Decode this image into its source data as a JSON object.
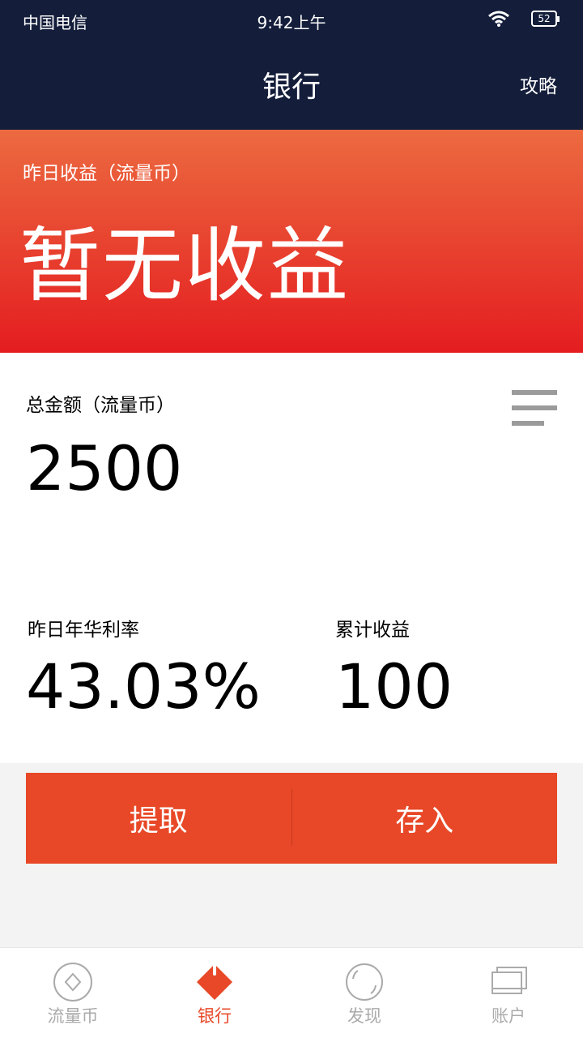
{
  "status_bar": {
    "carrier": "中国电信",
    "time": "9:42上午",
    "battery": "52"
  },
  "nav": {
    "title": "银行",
    "action": "攻略"
  },
  "hero": {
    "label": "昨日收益（流量币）",
    "value": "暂无收益"
  },
  "total": {
    "label": "总金额（流量币）",
    "value": "2500"
  },
  "stats": {
    "rate_label": "昨日年华利率",
    "rate_value": "43.03%",
    "cumulative_label": "累计收益",
    "cumulative_value": "100"
  },
  "actions": {
    "withdraw": "提取",
    "deposit": "存入"
  },
  "tabs": [
    {
      "label": "流量币",
      "icon": "coin-icon"
    },
    {
      "label": "银行",
      "icon": "bank-icon"
    },
    {
      "label": "发现",
      "icon": "discover-icon"
    },
    {
      "label": "账户",
      "icon": "account-icon"
    }
  ],
  "colors": {
    "nav_bg": "#141e3b",
    "accent": "#e84827",
    "hero_top": "#ec6a40",
    "hero_bottom": "#e41d20"
  }
}
